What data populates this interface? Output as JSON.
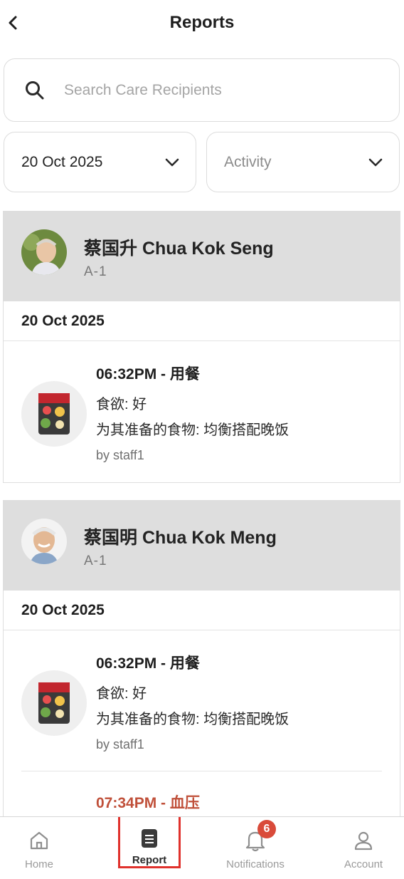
{
  "header": {
    "title": "Reports"
  },
  "search": {
    "placeholder": "Search Care Recipients"
  },
  "filters": {
    "date_value": "20 Oct 2025",
    "type_value": "Activity"
  },
  "recipients": [
    {
      "name": "蔡国升 Chua Kok Seng",
      "room": "A-1",
      "date": "20 Oct 2025",
      "entries": [
        {
          "time": "06:32PM - 用餐",
          "line1": "食欲: 好",
          "line2": "为其准备的食物: 均衡搭配晚饭",
          "by": "by staff1"
        }
      ]
    },
    {
      "name": "蔡国明 Chua Kok Meng",
      "room": "A-1",
      "date": "20 Oct 2025",
      "entries": [
        {
          "time": "06:32PM - 用餐",
          "line1": "食欲: 好",
          "line2": "为其准备的食物: 均衡搭配晚饭",
          "by": "by staff1"
        },
        {
          "time": "07:34PM - 血压"
        }
      ]
    }
  ],
  "nav": {
    "home": "Home",
    "report": "Report",
    "notifications": "Notifications",
    "notifications_badge": "6",
    "account": "Account",
    "active": "report"
  },
  "colors": {
    "accent_red": "#e0312c",
    "badge": "#d94b3a",
    "header_band": "#dedede",
    "bp_time": "#c0503a"
  }
}
